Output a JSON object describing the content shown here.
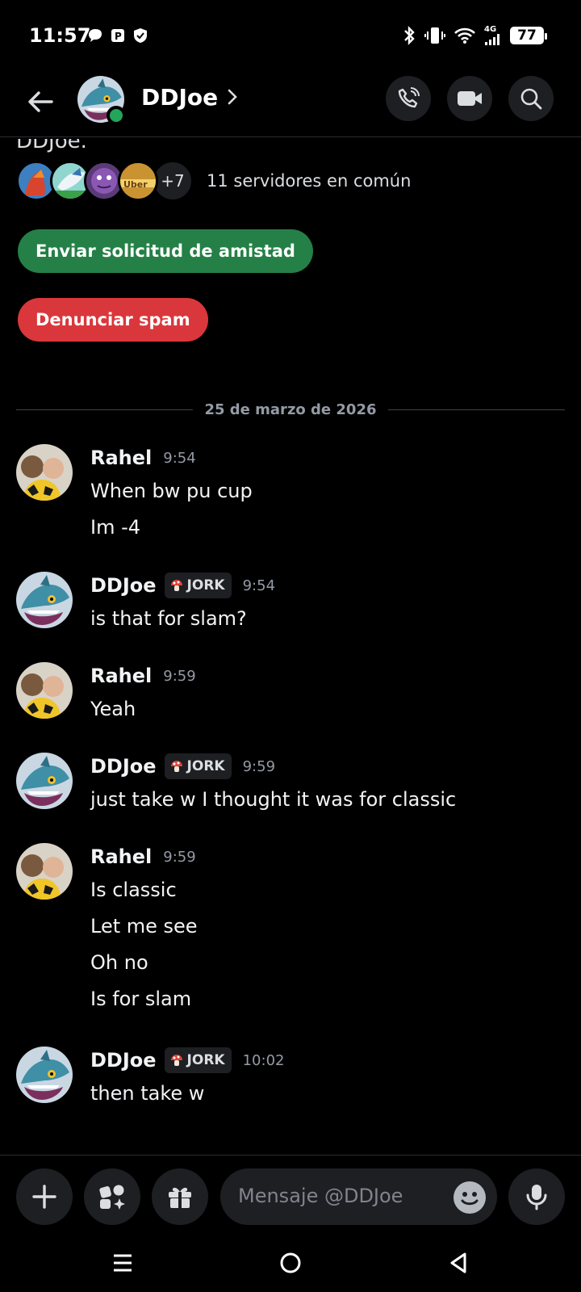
{
  "status_bar": {
    "time": "11:57",
    "network": "4G",
    "battery": "77",
    "left_icons": [
      "chat-bubble-icon",
      "parking-icon",
      "shield-icon"
    ],
    "right_icons": [
      "bluetooth-icon",
      "vibrate-icon",
      "wifi-icon",
      "signal-icon"
    ]
  },
  "header": {
    "name": "DDJoe",
    "status": "online",
    "buttons": [
      "voice-call-icon",
      "video-call-icon",
      "search-icon"
    ]
  },
  "profile": {
    "cut_text": "DDJoe.",
    "servers_more": "+7",
    "servers_common": "11 servidores en común",
    "add_friend_label": "Enviar solicitud de amistad",
    "report_spam_label": "Denunciar spam"
  },
  "date_divider": "25 de marzo de 2026",
  "messages": [
    {
      "author": "Rahel",
      "time": "9:54",
      "lines": [
        "When bw pu cup",
        "Im -4"
      ]
    },
    {
      "author": "DDJoe",
      "tag": "JORK",
      "time": "9:54",
      "lines": [
        "is that for slam?"
      ]
    },
    {
      "author": "Rahel",
      "time": "9:59",
      "lines": [
        "Yeah"
      ]
    },
    {
      "author": "DDJoe",
      "tag": "JORK",
      "time": "9:59",
      "lines": [
        "just take w I thought it was for classic"
      ]
    },
    {
      "author": "Rahel",
      "time": "9:59",
      "lines": [
        "Is classic",
        "Let me see",
        "Oh no",
        "Is for slam"
      ]
    },
    {
      "author": "DDJoe",
      "tag": "JORK",
      "time": "10:02",
      "lines": [
        "then take w"
      ]
    }
  ],
  "composer": {
    "placeholder": "Mensaje @DDJoe"
  },
  "colors": {
    "background": "#000000",
    "green_button": "#248046",
    "red_button": "#da373c",
    "online": "#23a55a",
    "muted": "#949ba4"
  }
}
